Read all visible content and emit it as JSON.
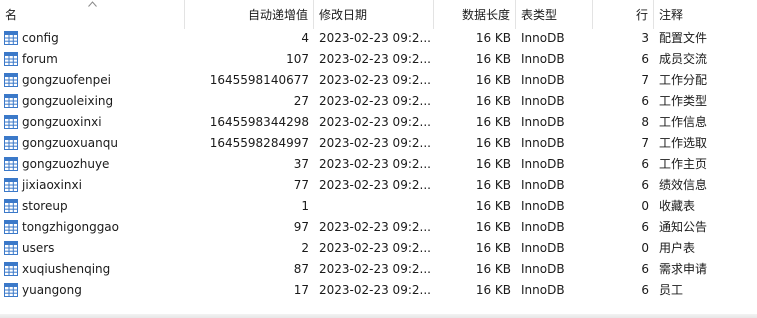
{
  "columns": {
    "name": "名",
    "auto_increment": "自动递增值",
    "modified": "修改日期",
    "data_length": "数据长度",
    "engine": "表类型",
    "rows": "行",
    "comment": "注释"
  },
  "icon": "table-icon",
  "tables": [
    {
      "name": "config",
      "auto_increment": "4",
      "modified": "2023-02-23 09:2...",
      "data_length": "16 KB",
      "engine": "InnoDB",
      "rows": "3",
      "comment": "配置文件"
    },
    {
      "name": "forum",
      "auto_increment": "107",
      "modified": "2023-02-23 09:2...",
      "data_length": "16 KB",
      "engine": "InnoDB",
      "rows": "6",
      "comment": "成员交流"
    },
    {
      "name": "gongzuofenpei",
      "auto_increment": "1645598140677",
      "modified": "2023-02-23 09:2...",
      "data_length": "16 KB",
      "engine": "InnoDB",
      "rows": "7",
      "comment": "工作分配"
    },
    {
      "name": "gongzuoleixing",
      "auto_increment": "27",
      "modified": "2023-02-23 09:2...",
      "data_length": "16 KB",
      "engine": "InnoDB",
      "rows": "6",
      "comment": "工作类型"
    },
    {
      "name": "gongzuoxinxi",
      "auto_increment": "1645598344298",
      "modified": "2023-02-23 09:2...",
      "data_length": "16 KB",
      "engine": "InnoDB",
      "rows": "8",
      "comment": "工作信息"
    },
    {
      "name": "gongzuoxuanqu",
      "auto_increment": "1645598284997",
      "modified": "2023-02-23 09:2...",
      "data_length": "16 KB",
      "engine": "InnoDB",
      "rows": "7",
      "comment": "工作选取"
    },
    {
      "name": "gongzuozhuye",
      "auto_increment": "37",
      "modified": "2023-02-23 09:2...",
      "data_length": "16 KB",
      "engine": "InnoDB",
      "rows": "6",
      "comment": "工作主页"
    },
    {
      "name": "jixiaoxinxi",
      "auto_increment": "77",
      "modified": "2023-02-23 09:2...",
      "data_length": "16 KB",
      "engine": "InnoDB",
      "rows": "6",
      "comment": "绩效信息"
    },
    {
      "name": "storeup",
      "auto_increment": "1",
      "modified": "",
      "data_length": "16 KB",
      "engine": "InnoDB",
      "rows": "0",
      "comment": "收藏表"
    },
    {
      "name": "tongzhigonggao",
      "auto_increment": "97",
      "modified": "2023-02-23 09:2...",
      "data_length": "16 KB",
      "engine": "InnoDB",
      "rows": "6",
      "comment": "通知公告"
    },
    {
      "name": "users",
      "auto_increment": "2",
      "modified": "2023-02-23 09:2...",
      "data_length": "16 KB",
      "engine": "InnoDB",
      "rows": "0",
      "comment": "用户表"
    },
    {
      "name": "xuqiushenqing",
      "auto_increment": "87",
      "modified": "2023-02-23 09:2...",
      "data_length": "16 KB",
      "engine": "InnoDB",
      "rows": "6",
      "comment": "需求申请"
    },
    {
      "name": "yuangong",
      "auto_increment": "17",
      "modified": "2023-02-23 09:2...",
      "data_length": "16 KB",
      "engine": "InnoDB",
      "rows": "6",
      "comment": "员工"
    }
  ]
}
